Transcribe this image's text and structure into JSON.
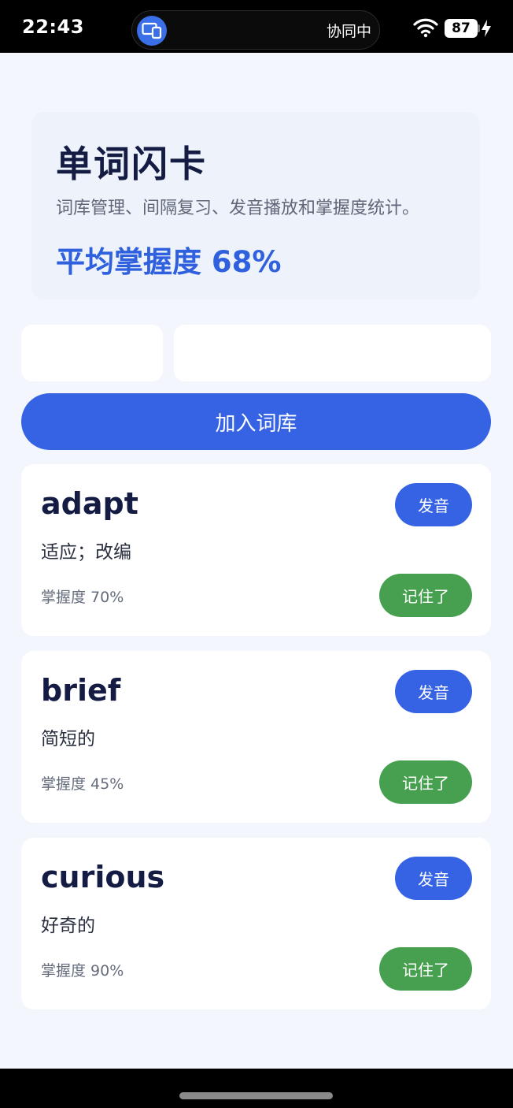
{
  "status_bar": {
    "time": "22:43",
    "collab_text": "协同中",
    "battery": "87",
    "icons": [
      "screen-share-icon",
      "wifi-icon",
      "charging-bolt-icon"
    ]
  },
  "header": {
    "title": "单词闪卡",
    "subtitle": "词库管理、间隔复习、发音播放和掌握度统计。",
    "average_mastery": "平均掌握度 68%"
  },
  "form": {
    "word_value": "",
    "meaning_value": "",
    "add_label": "加入词库"
  },
  "cards": [
    {
      "word": "adapt",
      "meaning": "适应；改编",
      "mastery_text": "掌握度 70%",
      "mastery": 0.7,
      "pron_label": "发音",
      "remember_label": "记住了"
    },
    {
      "word": "brief",
      "meaning": "简短的",
      "mastery_text": "掌握度 45%",
      "mastery": 0.45,
      "pron_label": "发音",
      "remember_label": "记住了"
    },
    {
      "word": "curious",
      "meaning": "好奇的",
      "mastery_text": "掌握度 90%",
      "mastery": 0.9,
      "pron_label": "发音",
      "remember_label": "记住了"
    }
  ],
  "colors": {
    "primary": "#3563e3",
    "success": "#46a04f",
    "title": "#141c44",
    "background": "#f3f6fc"
  }
}
